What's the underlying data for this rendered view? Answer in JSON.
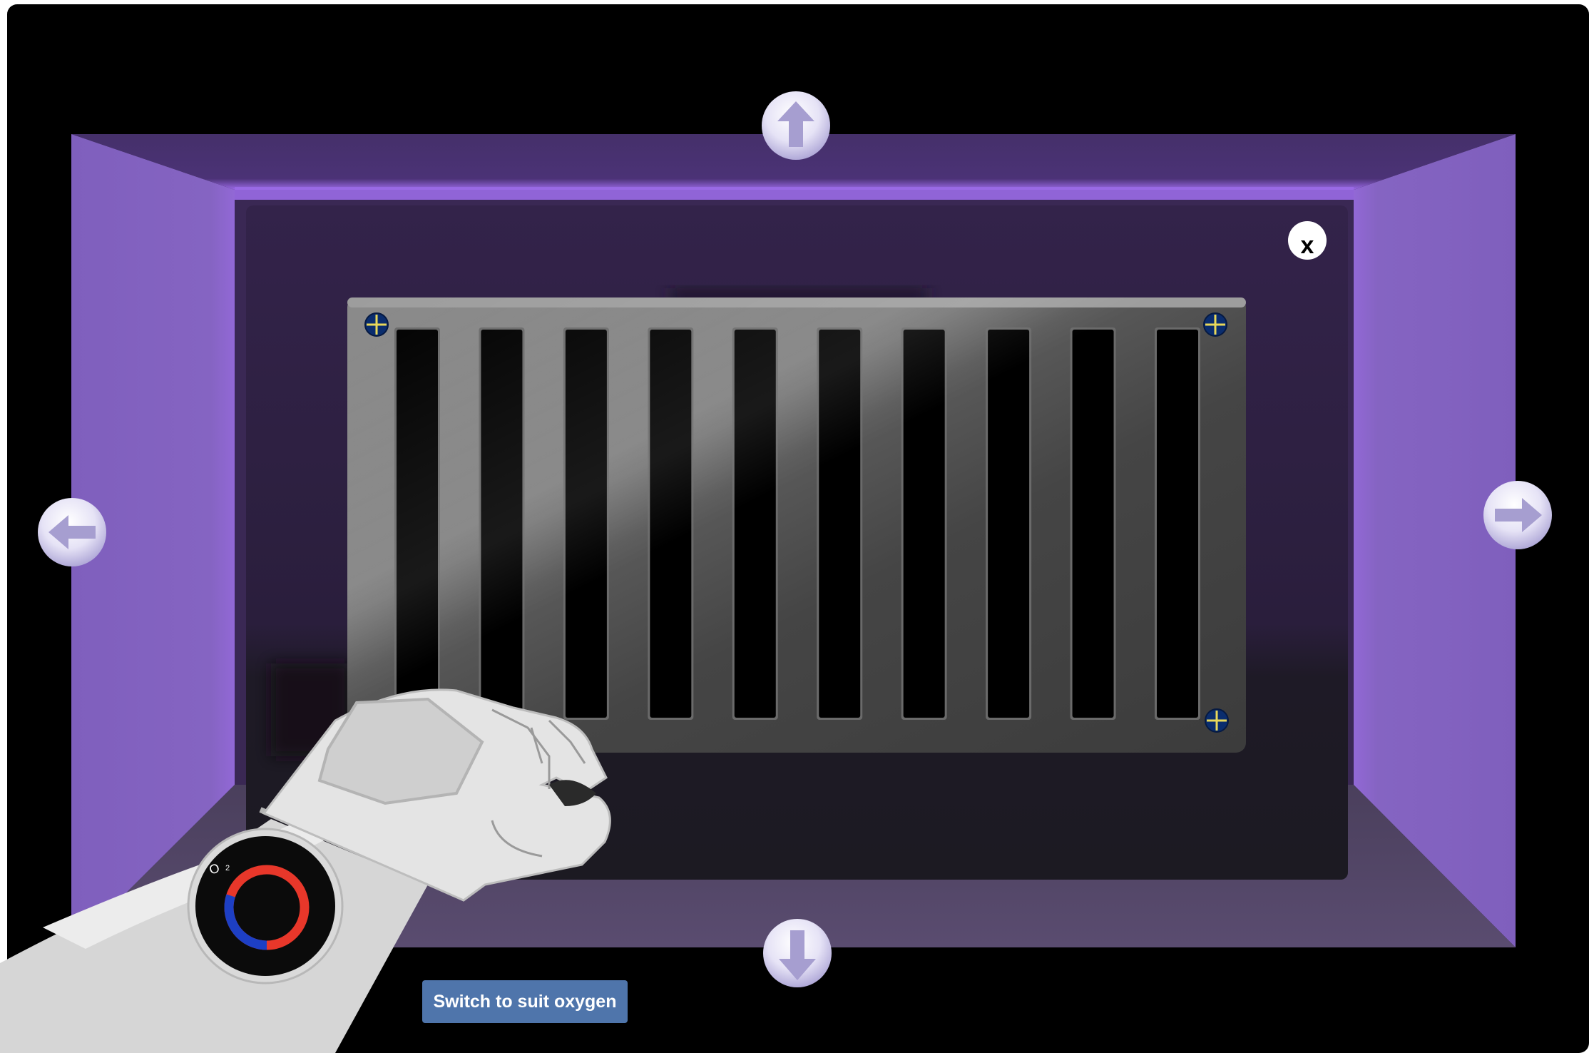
{
  "buttons": {
    "oxygen_label": "Switch to suit oxygen",
    "close_label": "x"
  },
  "gauge": {
    "label": "O",
    "label_sub": "2",
    "oxygen_level": 0.3,
    "level_color": "#1d3fc4",
    "depleted_color": "#e8372a"
  },
  "navigation": [
    "up-arrow-icon",
    "down-arrow-icon",
    "left-arrow-icon",
    "right-arrow-icon"
  ],
  "vent": {
    "slot_count": 10,
    "screws_remaining": 3
  },
  "colors": {
    "room_wall": "#8162bf",
    "room_ceiling": "#45306a",
    "room_floor": "#544868",
    "panel": "#33234a",
    "vent_metal": "#4a4a4a",
    "screw": "#0a2d6e",
    "screw_cross": "#e8d85a",
    "button": "#4f75ab"
  }
}
